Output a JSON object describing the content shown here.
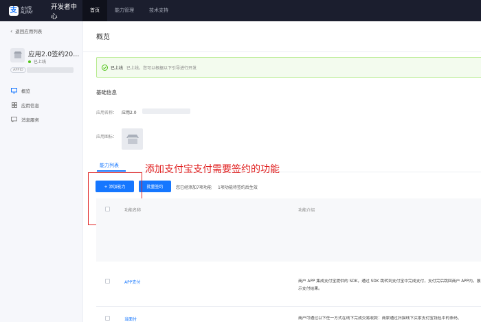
{
  "topbar": {
    "logo_glyph": "支",
    "logo_sub": "支付宝 ALIPAY",
    "brand_title": "开发者中心",
    "nav": [
      {
        "label": "首页",
        "active": true
      },
      {
        "label": "能力管理",
        "active": false
      },
      {
        "label": "技术支持",
        "active": false
      }
    ]
  },
  "sidebar": {
    "back_label": "返回应用列表",
    "app_name": "应用2.0签约20...",
    "app_status": "已上线",
    "appid_tag": "APPID",
    "menu": [
      {
        "label": "概览",
        "icon": "monitor-icon"
      },
      {
        "label": "应用信息",
        "icon": "grid-icon"
      },
      {
        "label": "消息服务",
        "icon": "message-icon"
      }
    ]
  },
  "main": {
    "title": "概览",
    "alert": {
      "strong": "已上线",
      "text": "已上线，您可以根据以下引导进行开发"
    },
    "basic_info": {
      "title": "基础信息",
      "name_label": "应用名称：",
      "name_value": "应用2.0",
      "icon_label": "应用图标："
    },
    "tab_label": "能力列表",
    "annotation": "添加支付宝支付需要签约的功能",
    "toolbar": {
      "add_label": "+ 添加能力",
      "batch_label": "批量签约",
      "hint_added": "您已经添加7项功能",
      "hint_pending": "1项功能待签约后生效"
    },
    "table": {
      "headers": [
        "功能名称",
        "功能介绍"
      ],
      "rows": [
        {
          "name": "APP支付",
          "desc": "商户 APP 集成支付宝提供的 SDK，通过 SDK 跳转到支付宝中完成支付，支付完后跳回商户 APP内，展示支付结果。"
        },
        {
          "name": "当面付",
          "desc": "商户可通过以下任一方式在线下完成交易收款：商家通过扫描线下买家支付宝钱包中的条码、"
        }
      ]
    }
  },
  "colors": {
    "accent": "#1677ff",
    "annotation": "#e02020",
    "success": "#52c41a",
    "topbar": "#1b1e2e"
  }
}
